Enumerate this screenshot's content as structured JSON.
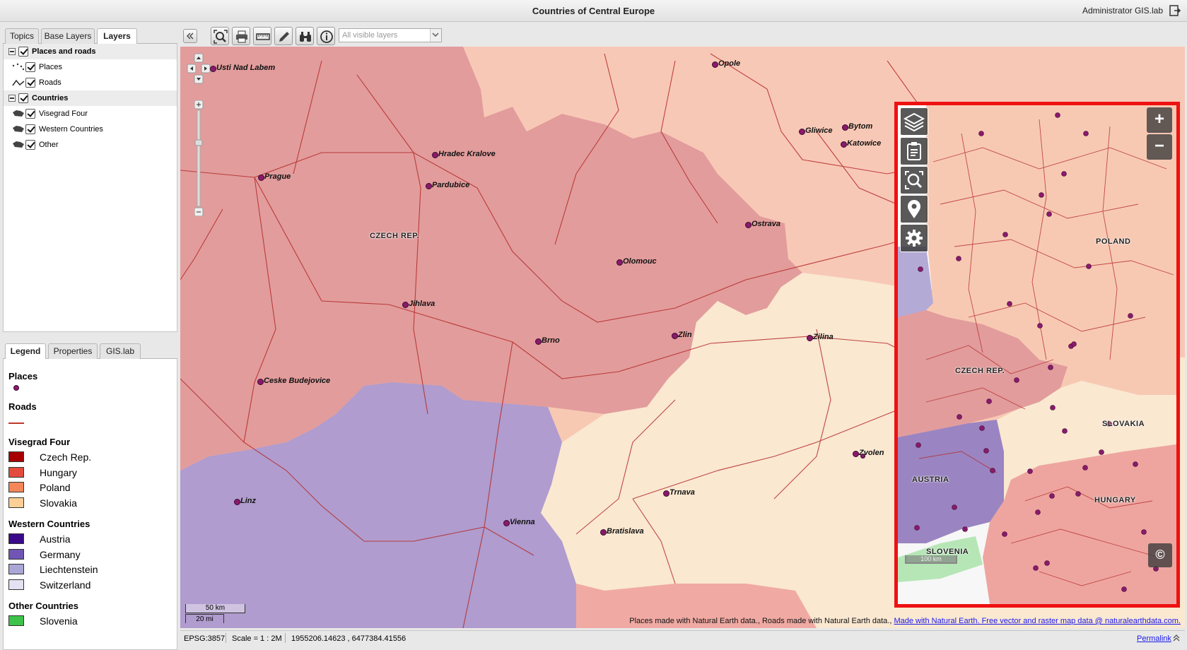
{
  "header": {
    "title": "Countries of Central Europe",
    "user": "Administrator GIS.lab"
  },
  "left_tabs": [
    "Topics",
    "Base Layers",
    "Layers"
  ],
  "layer_tree": {
    "groups": [
      {
        "label": "Places and roads",
        "children": [
          "Places",
          "Roads"
        ]
      },
      {
        "label": "Countries",
        "children": [
          "Visegrad Four",
          "Western Countries",
          "Other"
        ]
      }
    ]
  },
  "legend_tabs": [
    "Legend",
    "Properties",
    "GIS.lab"
  ],
  "legend": {
    "places": "Places",
    "roads": "Roads",
    "visegrad": {
      "title": "Visegrad Four",
      "items": [
        {
          "label": "Czech Rep.",
          "color": "#a80000"
        },
        {
          "label": "Hungary",
          "color": "#e34c3c"
        },
        {
          "label": "Poland",
          "color": "#f4875a"
        },
        {
          "label": "Slovakia",
          "color": "#fbcf95"
        }
      ]
    },
    "western": {
      "title": "Western Countries",
      "items": [
        {
          "label": "Austria",
          "color": "#3a0a8a"
        },
        {
          "label": "Germany",
          "color": "#7055b5"
        },
        {
          "label": "Liechtenstein",
          "color": "#aaa6d6"
        },
        {
          "label": "Switzerland",
          "color": "#e4e1f3"
        }
      ]
    },
    "other": {
      "title": "Other Countries",
      "items": [
        {
          "label": "Slovenia",
          "color": "#3dc24a"
        }
      ]
    }
  },
  "toolbar": {
    "layer_select": "All visible layers"
  },
  "map": {
    "cities": [
      "Usti Nad Labem",
      "Opole",
      "Gliwice",
      "Bytom",
      "Katowice",
      "Hradec Kralove",
      "Prague",
      "Pardubice",
      "Ostrava",
      "Olomouc",
      "Jihlava",
      "Brno",
      "Zlin",
      "Zilina",
      "Ceske Budejovice",
      "Zvolen",
      "Trnava",
      "Linz",
      "Vienna",
      "Bratislava"
    ],
    "countries": [
      "CZECH REP."
    ],
    "attribution_text": "Places made with Natural Earth data., Roads made with Natural Earth data., ",
    "attribution_link": "Made with Natural Earth. Free vector and raster map data @ naturalearthdata.com.",
    "scale_km": "50 km",
    "scale_mi": "20 mi"
  },
  "mobile": {
    "countries": [
      "POLAND",
      "CZECH REP.",
      "SLOVAKIA",
      "AUSTRIA",
      "HUNGARY",
      "SLOVENIA"
    ],
    "scale": "100 km"
  },
  "status": {
    "epsg": "EPSG:3857",
    "scale": "Scale = 1 : 2M",
    "coords": "1955206.14623 , 6477384.41556",
    "permalink": "Permalink"
  }
}
